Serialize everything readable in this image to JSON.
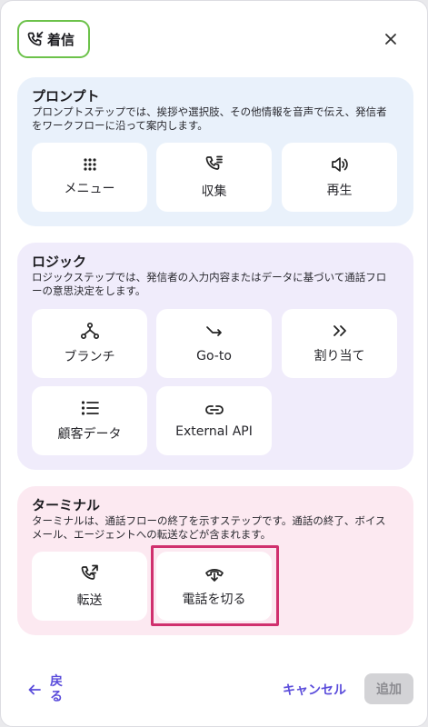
{
  "header": {
    "title": "着信",
    "icon": "incoming-call-icon"
  },
  "prompt": {
    "title": "プロンプト",
    "description": "プロンプトステップでは、挨拶や選択肢、その他情報を音声で伝え、発信者をワークフローに沿って案内します。",
    "items": [
      {
        "label": "メニュー",
        "icon": "grid-dots-icon"
      },
      {
        "label": "収集",
        "icon": "phone-keypad-icon"
      },
      {
        "label": "再生",
        "icon": "speaker-icon"
      }
    ]
  },
  "logic": {
    "title": "ロジック",
    "description": "ロジックステップでは、発信者の入力内容またはデータに基づいて通話フローの意思決定をします。",
    "items": [
      {
        "label": "ブランチ",
        "icon": "branch-icon"
      },
      {
        "label": "Go-to",
        "icon": "goto-arrow-icon"
      },
      {
        "label": "割り当て",
        "icon": "double-chevron-icon"
      },
      {
        "label": "顧客データ",
        "icon": "list-icon"
      },
      {
        "label": "External API",
        "icon": "link-icon"
      }
    ]
  },
  "terminal": {
    "title": "ターミナル",
    "description": "ターミナルは、通話フローの終了を示すステップです。通話の終了、ボイスメール、エージェントへの転送などが含まれます。",
    "items": [
      {
        "label": "転送",
        "icon": "phone-transfer-icon"
      },
      {
        "label": "電話を切る",
        "icon": "hang-up-icon"
      }
    ]
  },
  "footer": {
    "back_label": "戻る",
    "cancel_label": "キャンセル",
    "add_label": "追加"
  },
  "colors": {
    "accent": "#5b4ddb",
    "chip_border": "#6cc24a",
    "highlight": "#d0306e"
  }
}
